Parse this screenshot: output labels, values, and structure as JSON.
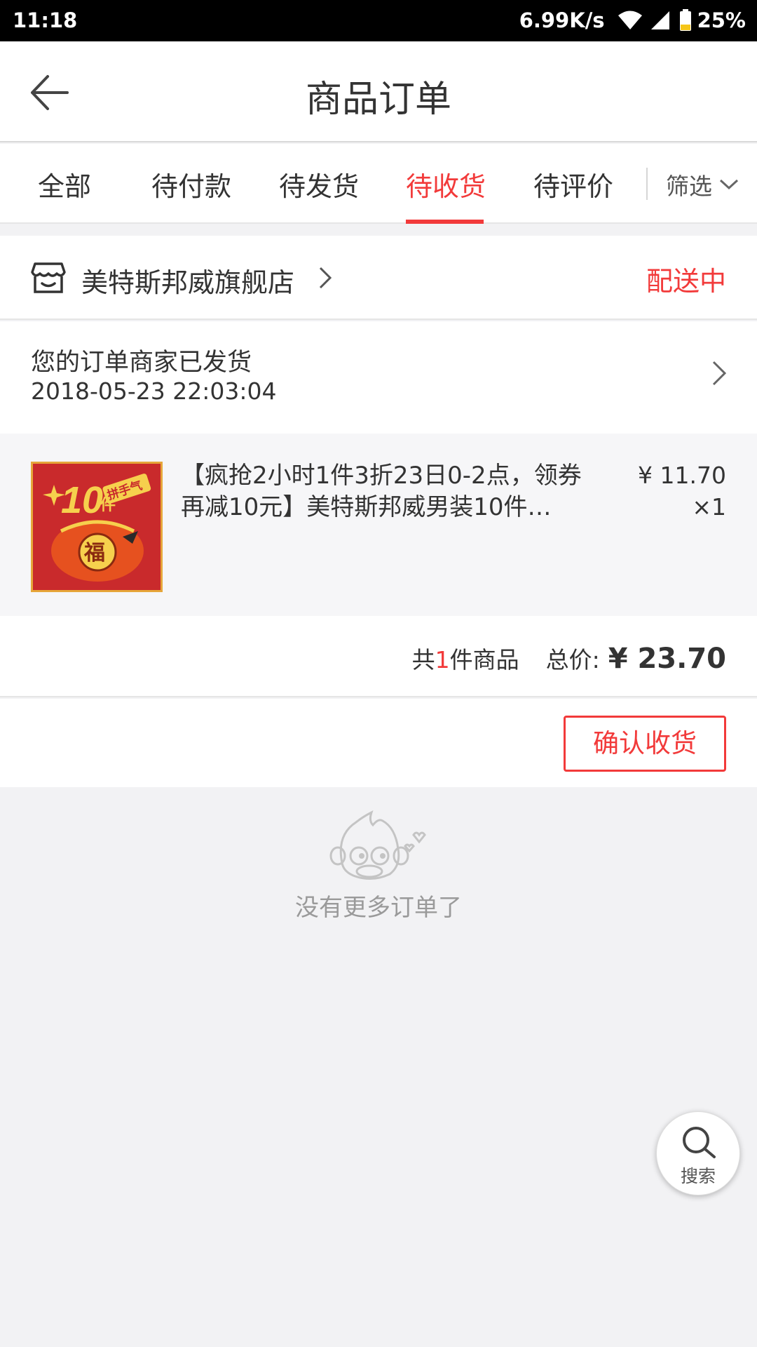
{
  "status_bar": {
    "time": "11:18",
    "net_speed": "6.99K/s",
    "battery": "25%"
  },
  "header": {
    "title": "商品订单"
  },
  "tabs": [
    {
      "label": "全部",
      "active": false
    },
    {
      "label": "待付款",
      "active": false
    },
    {
      "label": "待发货",
      "active": false
    },
    {
      "label": "待收货",
      "active": true
    },
    {
      "label": "待评价",
      "active": false
    }
  ],
  "filter": {
    "label": "筛选"
  },
  "order": {
    "shop_name": "美特斯邦威旗舰店",
    "status": "配送中",
    "ship_message": "您的订单商家已发货",
    "ship_time": "2018-05-23 22:03:04",
    "item": {
      "title": "【疯抢2小时1件3折23日0-2点，领券再减10元】美特斯邦威男装10件…",
      "price": "¥ 11.70",
      "qty": "×1",
      "thumb_text_big": "10",
      "thumb_text_jian": "件",
      "thumb_text_tag": "拼手气",
      "thumb_text_fu": "福"
    },
    "total": {
      "prefix": "共",
      "count": "1",
      "suffix": "件商品",
      "label": "总价:",
      "amount": "¥ 23.70"
    },
    "confirm_label": "确认收货"
  },
  "empty_text": "没有更多订单了",
  "fab": {
    "label": "搜索"
  },
  "colors": {
    "accent": "#f23a3a"
  }
}
